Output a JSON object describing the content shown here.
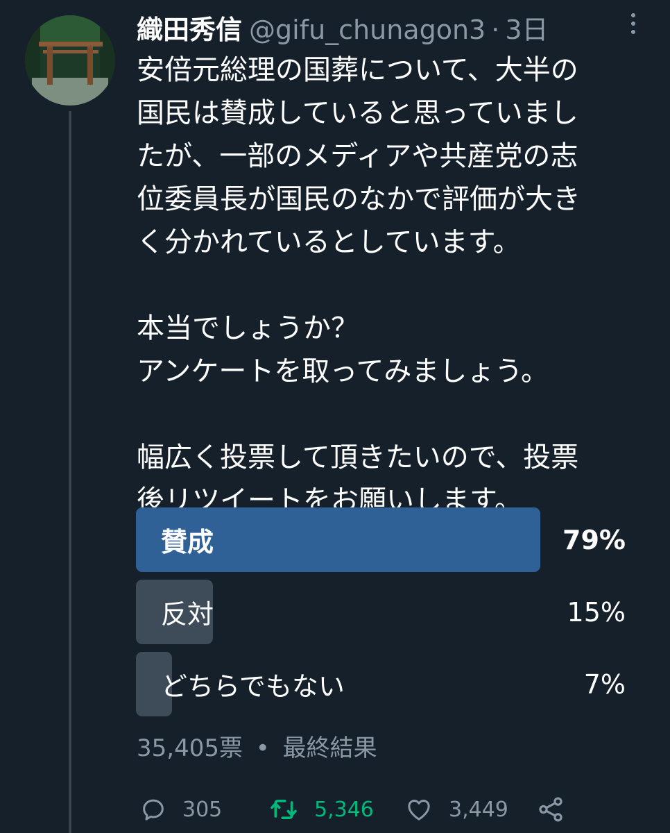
{
  "tweet": {
    "display_name": "織田秀信",
    "handle": "@gifu_chunagon3",
    "separator": "·",
    "time": "3日",
    "text_lines": [
      "安倍元総理の国葬について、大半の",
      "国民は賛成していると思っていまし",
      "たが、一部のメディアや共産党の志",
      "位委員長が国民のなかで評価が大き",
      "く分かれているとしています。",
      "",
      "本当でしょうか？",
      "アンケートを取ってみましょう。",
      "",
      "幅広く投票して頂きたいので、投票",
      "後リツイートをお願いします。"
    ]
  },
  "poll": {
    "options": [
      {
        "label": "賛成",
        "percent_text": "79%",
        "percent": 79,
        "winner": true
      },
      {
        "label": "反対",
        "percent_text": "15%",
        "percent": 15,
        "winner": false
      },
      {
        "label": "どちらでもない",
        "percent_text": "7%",
        "percent": 7,
        "winner": false
      }
    ],
    "votes": "35,405票",
    "meta_separator": "•",
    "status": "最終結果"
  },
  "actions": {
    "reply_count": "305",
    "retweet_count": "5,346",
    "like_count": "3,449"
  },
  "icons": {
    "reply": "reply-icon",
    "retweet": "retweet-icon",
    "like": "heart-icon",
    "share": "share-icon",
    "more": "more-icon"
  },
  "colors": {
    "background": "#15202b",
    "winner_bar": "#2f6197",
    "other_bar": "#3e4c5a",
    "muted": "#8b98a5",
    "retweet_green": "#00ba7c",
    "thread_line": "#38444d"
  }
}
